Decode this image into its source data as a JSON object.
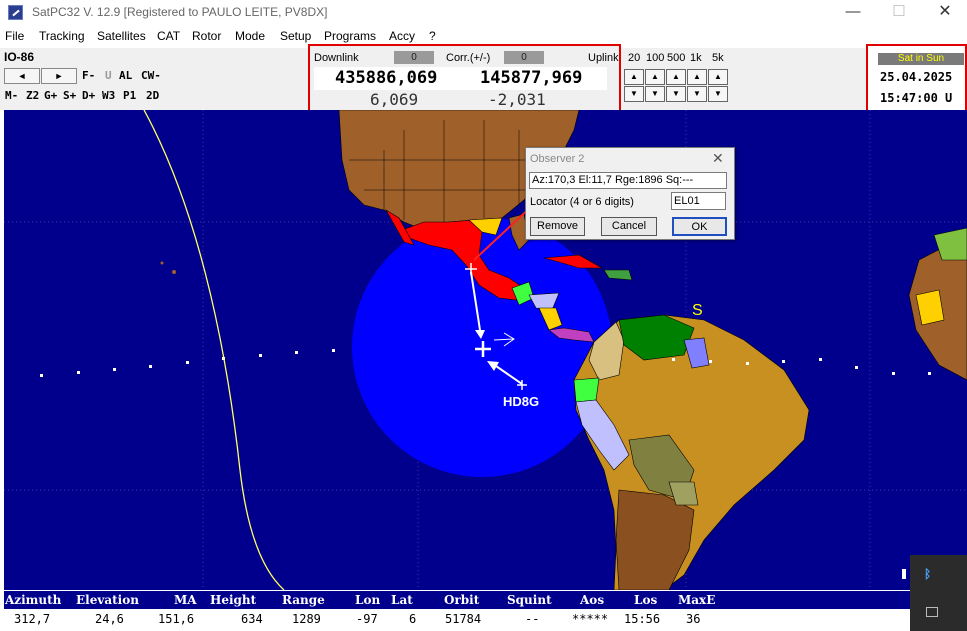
{
  "window": {
    "title": "SatPC32 V. 12.9   [Registered to PAULO LEITE, PV8DX]",
    "min_glyph": "—",
    "max_glyph": "☐",
    "close_glyph": "✕"
  },
  "menu": [
    "File",
    "Tracking",
    "Satellites",
    "CAT",
    "Rotor",
    "Mode",
    "Setup",
    "Programs",
    "Accy",
    "?"
  ],
  "toolbar": {
    "satellite": "IO-86",
    "nav_prev": "◄",
    "nav_next": "►",
    "row1_labels": [
      "F-",
      "U",
      "AL",
      "CW-"
    ],
    "row2_labels": [
      "M-",
      "Z2",
      "G+",
      "S+",
      "D+",
      "W3",
      "P1",
      "2D"
    ]
  },
  "freq": {
    "downlink_label": "Downlink",
    "downlink_corr": "0",
    "corr_label": "Corr.(+/-)",
    "uplink_corr": "0",
    "uplink_label": "Uplink",
    "downlink_freq": "435886,069",
    "uplink_freq": "145877,969",
    "downlink_doppler": "6,069",
    "uplink_doppler": "-2,031"
  },
  "steps": {
    "labels": [
      "20",
      "100",
      "500",
      "1k",
      "5k"
    ],
    "up_glyph": "▲",
    "down_glyph": "▼"
  },
  "time": {
    "status": "Sat in Sun",
    "date": "25.04.2025",
    "clock": "15:47:00 U"
  },
  "map": {
    "sun_marker": "S",
    "station_label": "HD8G",
    "colors": {
      "ocean": "#00008c",
      "footprint": "#0000ff",
      "track": "#ffff66"
    }
  },
  "dialog": {
    "title": "Observer 2",
    "close_glyph": "✕",
    "info": "Az:170,3  El:11,7  Rge:1896  Sq:---",
    "locator_label": "Locator (4 or 6 digits)",
    "locator_value": "EL01",
    "remove": "Remove",
    "cancel": "Cancel",
    "ok": "OK"
  },
  "status": {
    "headers": [
      "Azimuth",
      "Elevation",
      "MA",
      "Height",
      "Range",
      "Lon",
      "Lat",
      "Orbit",
      "Squint",
      "Aos",
      "Los",
      "MaxE"
    ],
    "values": [
      "312,7",
      "24,6",
      "151,6",
      "634",
      "1289",
      "-97",
      "6",
      "51784",
      "--",
      "*****",
      "15:56",
      "36"
    ]
  },
  "tray": {
    "bluetooth_glyph": "ᛒ"
  }
}
